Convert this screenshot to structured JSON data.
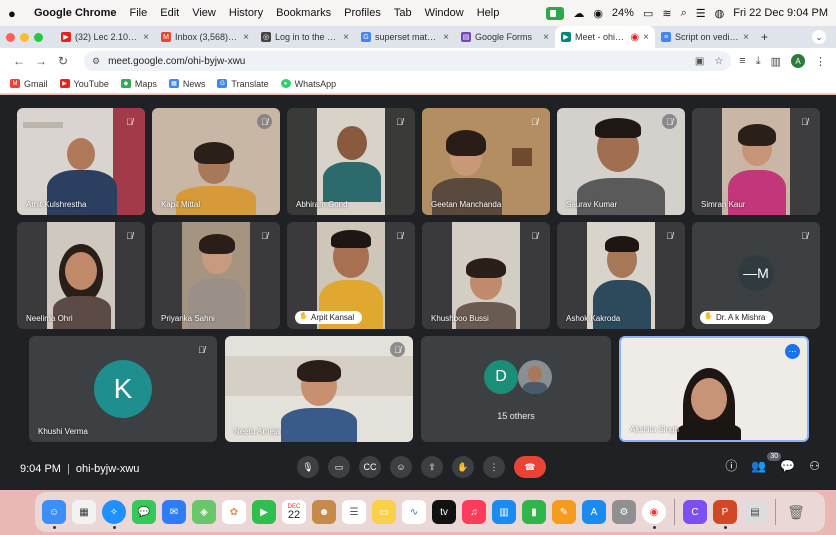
{
  "menubar": {
    "app_name": "Google Chrome",
    "items": [
      "File",
      "Edit",
      "View",
      "History",
      "Bookmarks",
      "Profiles",
      "Tab",
      "Window",
      "Help"
    ],
    "battery": "24%",
    "datetime": "Fri 22 Dec 9:04 PM"
  },
  "tabs": [
    {
      "label": "(32) Lec 2.10: The",
      "icon_color": "#e62117",
      "icon": "youtube-icon"
    },
    {
      "label": "Inbox (3,568) - hv",
      "icon_color": "#ea4335",
      "icon": "gmail-icon"
    },
    {
      "label": "Log in to the port",
      "icon_color": "#444444",
      "icon": "globe-icon"
    },
    {
      "label": "superset math - G",
      "icon_color": "#4285f4",
      "icon": "google-icon"
    },
    {
      "label": "Google Forms",
      "icon_color": "#7248b9",
      "icon": "forms-icon"
    },
    {
      "label": "Meet - ohi-byj",
      "icon_color": "#00897b",
      "icon": "meet-icon",
      "active": true
    },
    {
      "label": "Script on vedic m",
      "icon_color": "#4285f4",
      "icon": "docs-icon"
    }
  ],
  "address": {
    "url": "meet.google.com/ohi-byjw-xwu"
  },
  "profile_initial": "A",
  "bookmarks": [
    {
      "label": "Gmail",
      "color": "#ea4335",
      "letter": "M"
    },
    {
      "label": "YouTube",
      "color": "#e62117",
      "letter": "▶"
    },
    {
      "label": "Maps",
      "color": "#34a853",
      "letter": "◆"
    },
    {
      "label": "News",
      "color": "#4285f4",
      "letter": "▦"
    },
    {
      "label": "Translate",
      "color": "#4285f4",
      "letter": "G"
    },
    {
      "label": "WhatsApp",
      "color": "#25d366",
      "letter": "●"
    }
  ],
  "participants": {
    "row1": [
      "Amit Kulshrestha",
      "Kapil Mittal",
      "Abhiram Gond",
      "Geetan Manchanda",
      "Saurav Kumar",
      "Simran Kaur"
    ],
    "row2": [
      "Neelima Ohri",
      "Priyanka Sahni",
      "Arpit Kansal",
      "Khushboo Bussi",
      "Ashok Kakroda",
      "Dr. A k Mishra"
    ],
    "row3": [
      "Khushi Verma",
      "Neetu Arneja",
      "Akshita Singh"
    ]
  },
  "avatars": {
    "khushi": "K",
    "mishra": "—M",
    "others_initial": "D"
  },
  "others_label": "15 others",
  "controls": {
    "time": "9:04 PM",
    "separator": "|",
    "meeting_code": "ohi-byjw-xwu",
    "people_count": "30"
  },
  "dock": {
    "calendar_day": "22",
    "calendar_month": "DEC"
  }
}
